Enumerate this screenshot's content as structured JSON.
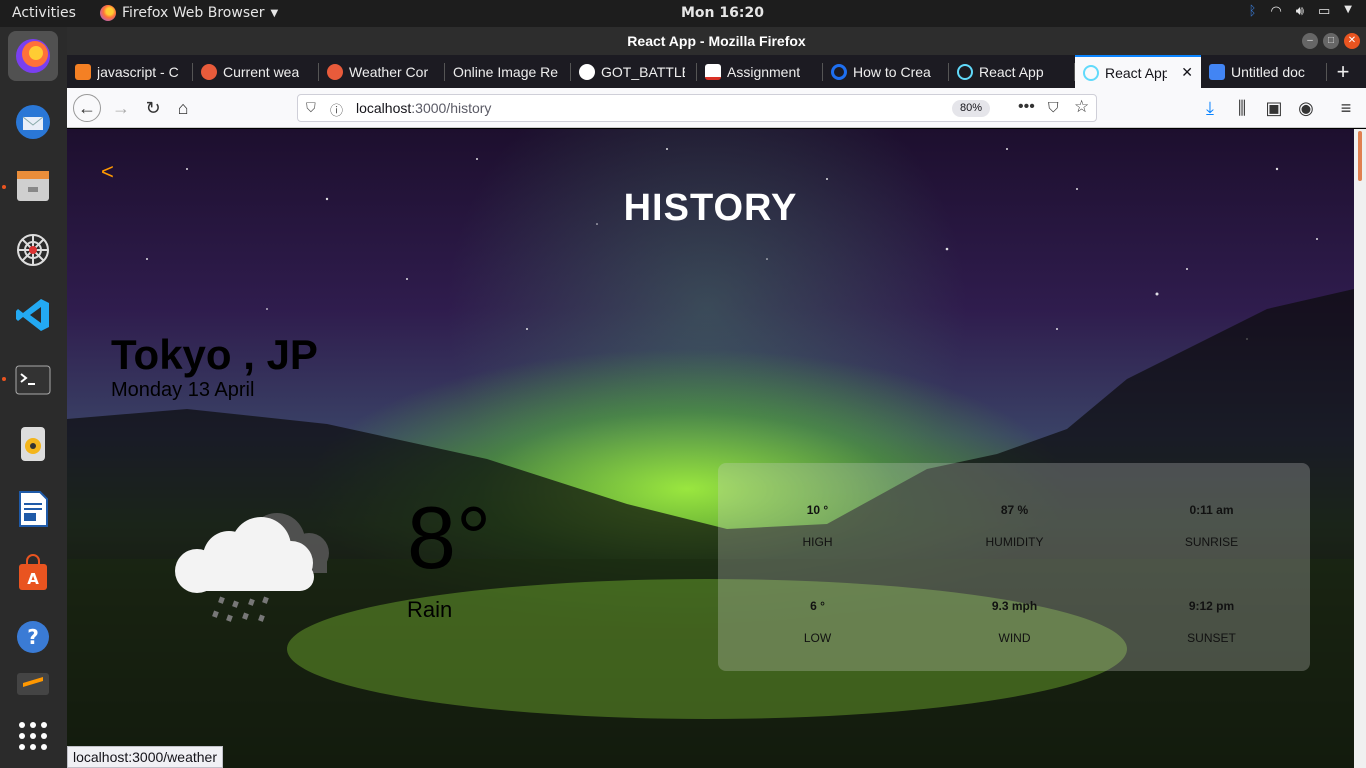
{
  "topbar": {
    "activities": "Activities",
    "app_menu": "Firefox Web Browser",
    "clock": "Mon 16:20"
  },
  "window": {
    "title": "React App - Mozilla Firefox"
  },
  "tabs": [
    {
      "label": "javascript - C",
      "icon": "stackoverflow-icon",
      "color": "#f48024"
    },
    {
      "label": "Current wea",
      "icon": "weather-api-icon",
      "color": "#e85b3b"
    },
    {
      "label": "Weather Cor",
      "icon": "weather-api-icon",
      "color": "#e85b3b"
    },
    {
      "label": "Online Image Re",
      "icon": "none",
      "color": ""
    },
    {
      "label": "GOT_BATTLE",
      "icon": "github-icon",
      "color": "#ffffff"
    },
    {
      "label": "Assignment",
      "icon": "gmail-icon",
      "color": "#d93025"
    },
    {
      "label": "How to Crea",
      "icon": "generic-site-icon",
      "color": "#1e6ff0"
    },
    {
      "label": "React App",
      "icon": "react-icon",
      "color": "#61dafb"
    },
    {
      "label": "React App",
      "icon": "react-icon",
      "color": "#61dafb",
      "active": true
    },
    {
      "label": "Untitled doc",
      "icon": "google-docs-icon",
      "color": "#4285f4"
    }
  ],
  "navbar": {
    "url_host": "localhost",
    "url_path": ":3000/history",
    "zoom": "80%"
  },
  "page": {
    "back_symbol": "<",
    "title": "HISTORY",
    "city": "Tokyo , JP",
    "date": "Monday 13 April",
    "temperature": "8°",
    "condition": "Rain",
    "weather_icon": "cloud-rain-icon"
  },
  "stats": {
    "high_value": "10 °",
    "high_label": "HIGH",
    "humidity_value": "87 %",
    "humidity_label": "HUMIDITY",
    "sunrise_value": "0:11 am",
    "sunrise_label": "SUNRISE",
    "low_value": "6 °",
    "low_label": "LOW",
    "wind_value": "9.3 mph",
    "wind_label": "WIND",
    "sunset_value": "9:12 pm",
    "sunset_label": "SUNSET"
  },
  "status_bar": {
    "link_url": "localhost:3000/weather"
  },
  "colors": {
    "accent": "#ff9900",
    "tab_highlight": "#0a84ff",
    "ubuntu_orange": "#e95420"
  }
}
